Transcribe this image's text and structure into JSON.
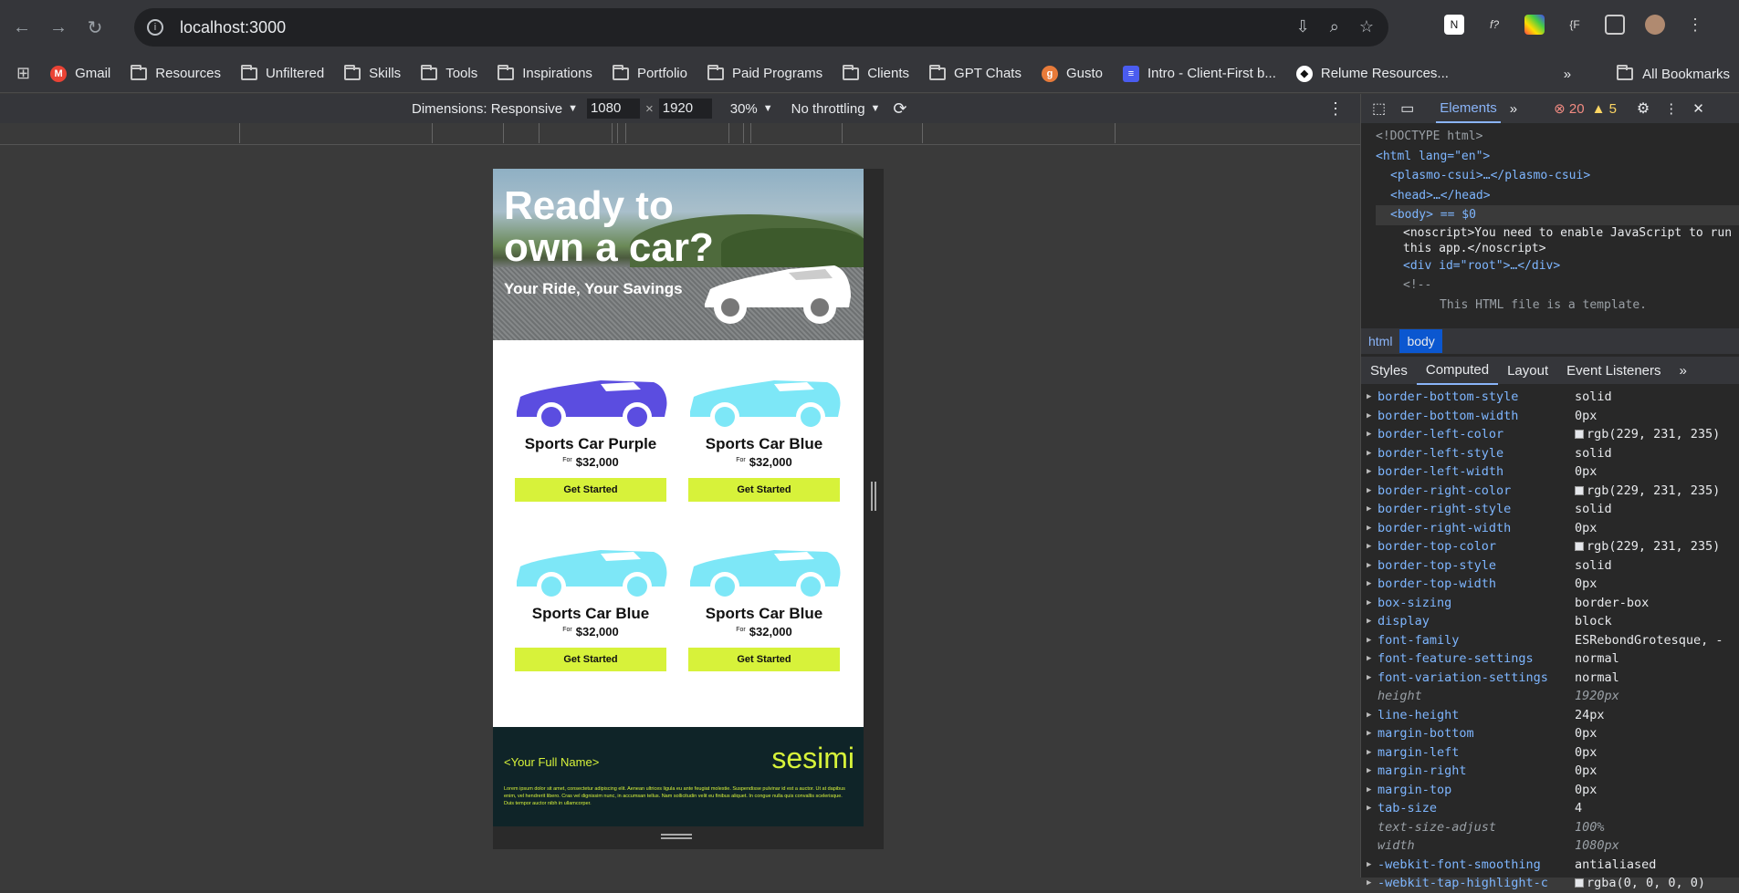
{
  "browser": {
    "url": "localhost:3000",
    "bookmarks": [
      "Gmail",
      "Resources",
      "Unfiltered",
      "Skills",
      "Tools",
      "Inspirations",
      "Portfolio",
      "Paid Programs",
      "Clients",
      "GPT Chats",
      "Gusto",
      "Intro - Client-First b...",
      "Relume Resources..."
    ],
    "all_bookmarks": "All Bookmarks",
    "more_bookmarks": "»"
  },
  "device_toolbar": {
    "dimensions_label": "Dimensions: Responsive",
    "width": "1080",
    "height": "1920",
    "times": "×",
    "zoom": "30%",
    "throttling": "No throttling"
  },
  "page": {
    "hero_title": "Ready to own a car?",
    "hero_subtitle": "Your Ride, Your Savings",
    "cards": [
      {
        "name": "Sports Car Purple",
        "for": "For",
        "price": "$32,000",
        "cta": "Get Started",
        "color": "#5b4de0"
      },
      {
        "name": "Sports Car Blue",
        "for": "For",
        "price": "$32,000",
        "cta": "Get Started",
        "color": "#7de7f7"
      },
      {
        "name": "Sports Car Blue",
        "for": "For",
        "price": "$32,000",
        "cta": "Get Started",
        "color": "#7de7f7"
      },
      {
        "name": "Sports Car Blue",
        "for": "For",
        "price": "$32,000",
        "cta": "Get Started",
        "color": "#7de7f7"
      }
    ],
    "footer_name": "<Your Full Name>",
    "footer_logo": "sesimi",
    "footer_lorem": "Lorem ipsum dolor sit amet, consectetur adipiscing elit. Aenean ultrices ligula eu ante feugiat molestie. Suspendisse pulvinar id est a auctor. Ut at dapibus enim, vel hendrerit libero. Cras vel dignissim nunc, in accumsan tellus. Nam sollicitudin velit eu finibus aliquet. In congue nulla quis convallis scelerisque. Duis tempor auctor nibh in ullamcorper."
  },
  "devtools": {
    "tab_elements": "Elements",
    "more_tabs": "»",
    "errors": "20",
    "warnings": "5",
    "dom": {
      "doctype": "<!DOCTYPE html>",
      "html_open": "<html lang=\"en\">",
      "plasmo": "<plasmo-csui>…</plasmo-csui>",
      "head": "<head>…</head>",
      "body": "<body> == $0",
      "noscript": "<noscript>You need to enable JavaScript to run this app.</noscript>",
      "root": "<div id=\"root\">…</div>",
      "comment_open": "<!--",
      "comment_text": "This HTML file is a template."
    },
    "crumbs": [
      "html",
      "body"
    ],
    "subtabs": [
      "Styles",
      "Computed",
      "Layout",
      "Event Listeners"
    ],
    "props": [
      {
        "name": "border-bottom-style",
        "value": "solid"
      },
      {
        "name": "border-bottom-width",
        "value": "0px"
      },
      {
        "name": "border-left-color",
        "value": "rgb(229, 231, 235)",
        "swatch": true
      },
      {
        "name": "border-left-style",
        "value": "solid"
      },
      {
        "name": "border-left-width",
        "value": "0px"
      },
      {
        "name": "border-right-color",
        "value": "rgb(229, 231, 235)",
        "swatch": true
      },
      {
        "name": "border-right-style",
        "value": "solid"
      },
      {
        "name": "border-right-width",
        "value": "0px"
      },
      {
        "name": "border-top-color",
        "value": "rgb(229, 231, 235)",
        "swatch": true
      },
      {
        "name": "border-top-style",
        "value": "solid"
      },
      {
        "name": "border-top-width",
        "value": "0px"
      },
      {
        "name": "box-sizing",
        "value": "border-box"
      },
      {
        "name": "display",
        "value": "block"
      },
      {
        "name": "font-family",
        "value": "ESRebondGrotesque, -"
      },
      {
        "name": "font-feature-settings",
        "value": "normal"
      },
      {
        "name": "font-variation-settings",
        "value": "normal"
      },
      {
        "name": "height",
        "value": "1920px",
        "italic": true
      },
      {
        "name": "line-height",
        "value": "24px"
      },
      {
        "name": "margin-bottom",
        "value": "0px"
      },
      {
        "name": "margin-left",
        "value": "0px"
      },
      {
        "name": "margin-right",
        "value": "0px"
      },
      {
        "name": "margin-top",
        "value": "0px"
      },
      {
        "name": "tab-size",
        "value": "4"
      },
      {
        "name": "text-size-adjust",
        "value": "100%",
        "italic": true
      },
      {
        "name": "width",
        "value": "1080px",
        "italic": true
      },
      {
        "name": "-webkit-font-smoothing",
        "value": "antialiased"
      },
      {
        "name": "-webkit-tap-highlight-c",
        "value": "rgba(0, 0, 0, 0)",
        "swatch": true
      }
    ]
  }
}
